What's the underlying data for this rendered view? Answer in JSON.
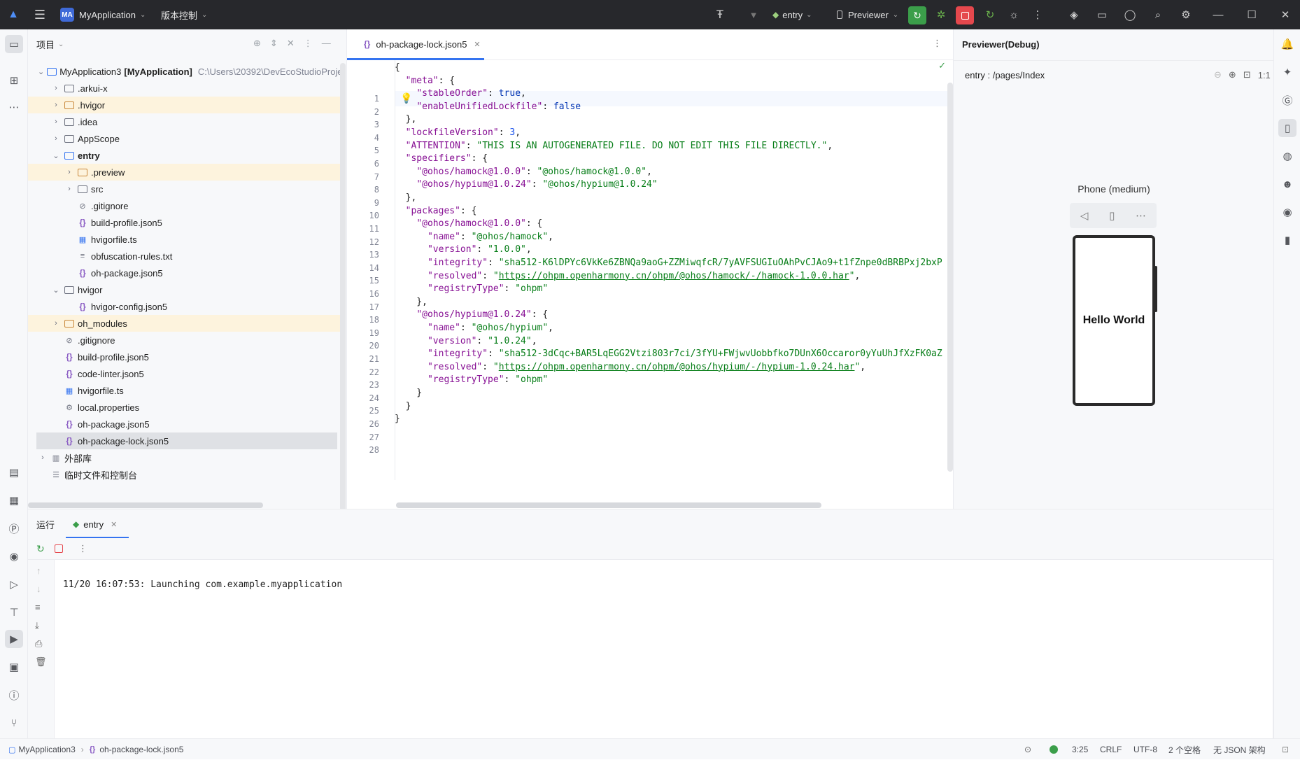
{
  "titlebar": {
    "project_initials": "MA",
    "project_name": "MyApplication",
    "vcs": "版本控制",
    "run_config": "entry",
    "device": "Previewer"
  },
  "project_panel": {
    "title": "项目",
    "root_name": "MyApplication3",
    "root_module": "[MyApplication]",
    "root_path": "C:\\Users\\20392\\DevEcoStudioProje",
    "items": [
      {
        "label": ".arkui-x"
      },
      {
        "label": ".hvigor"
      },
      {
        "label": ".idea"
      },
      {
        "label": "AppScope"
      },
      {
        "label": "entry"
      },
      {
        "label": ".preview"
      },
      {
        "label": "src"
      },
      {
        "label": ".gitignore"
      },
      {
        "label": "build-profile.json5"
      },
      {
        "label": "hvigorfile.ts"
      },
      {
        "label": "obfuscation-rules.txt"
      },
      {
        "label": "oh-package.json5"
      },
      {
        "label": "hvigor"
      },
      {
        "label": "hvigor-config.json5"
      },
      {
        "label": "oh_modules"
      },
      {
        "label": ".gitignore"
      },
      {
        "label": "build-profile.json5"
      },
      {
        "label": "code-linter.json5"
      },
      {
        "label": "hvigorfile.ts"
      },
      {
        "label": "local.properties"
      },
      {
        "label": "oh-package.json5"
      },
      {
        "label": "oh-package-lock.json5"
      },
      {
        "label": "外部库"
      },
      {
        "label": "临时文件和控制台"
      }
    ]
  },
  "editor": {
    "tab_label": "oh-package-lock.json5",
    "code": [
      {
        "t": [
          [
            "p",
            "{"
          ]
        ]
      },
      {
        "t": [
          [
            "p",
            "  "
          ],
          [
            "k",
            "\"meta\""
          ],
          [
            "p",
            ": {"
          ]
        ]
      },
      {
        "t": [
          [
            "p",
            "    "
          ],
          [
            "k",
            "\"stableOrder\""
          ],
          [
            "p",
            ": "
          ],
          [
            "b",
            "true"
          ],
          [
            "p",
            ","
          ]
        ]
      },
      {
        "t": [
          [
            "p",
            "    "
          ],
          [
            "k",
            "\"enableUnifiedLockfile\""
          ],
          [
            "p",
            ": "
          ],
          [
            "b",
            "false"
          ]
        ]
      },
      {
        "t": [
          [
            "p",
            "  },"
          ]
        ]
      },
      {
        "t": [
          [
            "p",
            "  "
          ],
          [
            "k",
            "\"lockfileVersion\""
          ],
          [
            "p",
            ": "
          ],
          [
            "n",
            "3"
          ],
          [
            "p",
            ","
          ]
        ]
      },
      {
        "t": [
          [
            "p",
            "  "
          ],
          [
            "k",
            "\"ATTENTION\""
          ],
          [
            "p",
            ": "
          ],
          [
            "s",
            "\"THIS IS AN AUTOGENERATED FILE. DO NOT EDIT THIS FILE DIRECTLY.\""
          ],
          [
            "p",
            ","
          ]
        ]
      },
      {
        "t": [
          [
            "p",
            "  "
          ],
          [
            "k",
            "\"specifiers\""
          ],
          [
            "p",
            ": {"
          ]
        ]
      },
      {
        "t": [
          [
            "p",
            "    "
          ],
          [
            "k",
            "\"@ohos/hamock@1.0.0\""
          ],
          [
            "p",
            ": "
          ],
          [
            "s",
            "\"@ohos/hamock@1.0.0\""
          ],
          [
            "p",
            ","
          ]
        ]
      },
      {
        "t": [
          [
            "p",
            "    "
          ],
          [
            "k",
            "\"@ohos/hypium@1.0.24\""
          ],
          [
            "p",
            ": "
          ],
          [
            "s",
            "\"@ohos/hypium@1.0.24\""
          ]
        ]
      },
      {
        "t": [
          [
            "p",
            "  },"
          ]
        ]
      },
      {
        "t": [
          [
            "p",
            "  "
          ],
          [
            "k",
            "\"packages\""
          ],
          [
            "p",
            ": {"
          ]
        ]
      },
      {
        "t": [
          [
            "p",
            "    "
          ],
          [
            "k",
            "\"@ohos/hamock@1.0.0\""
          ],
          [
            "p",
            ": {"
          ]
        ]
      },
      {
        "t": [
          [
            "p",
            "      "
          ],
          [
            "k",
            "\"name\""
          ],
          [
            "p",
            ": "
          ],
          [
            "s",
            "\"@ohos/hamock\""
          ],
          [
            "p",
            ","
          ]
        ]
      },
      {
        "t": [
          [
            "p",
            "      "
          ],
          [
            "k",
            "\"version\""
          ],
          [
            "p",
            ": "
          ],
          [
            "s",
            "\"1.0.0\""
          ],
          [
            "p",
            ","
          ]
        ]
      },
      {
        "t": [
          [
            "p",
            "      "
          ],
          [
            "k",
            "\"integrity\""
          ],
          [
            "p",
            ": "
          ],
          [
            "s",
            "\"sha512-K6lDPYc6VkKe6ZBNQa9aoG+ZZMiwqfcR/7yAVFSUGIuOAhPvCJAo9+t1fZnpe0dBRBPxj2bxP"
          ]
        ]
      },
      {
        "t": [
          [
            "p",
            "      "
          ],
          [
            "k",
            "\"resolved\""
          ],
          [
            "p",
            ": "
          ],
          [
            "s",
            "\""
          ],
          [
            "u",
            "https://ohpm.openharmony.cn/ohpm/@ohos/hamock/-/hamock-1.0.0.har"
          ],
          [
            "s",
            "\""
          ],
          [
            "p",
            ","
          ]
        ]
      },
      {
        "t": [
          [
            "p",
            "      "
          ],
          [
            "k",
            "\"registryType\""
          ],
          [
            "p",
            ": "
          ],
          [
            "s",
            "\"ohpm\""
          ]
        ]
      },
      {
        "t": [
          [
            "p",
            "    },"
          ]
        ]
      },
      {
        "t": [
          [
            "p",
            "    "
          ],
          [
            "k",
            "\"@ohos/hypium@1.0.24\""
          ],
          [
            "p",
            ": {"
          ]
        ]
      },
      {
        "t": [
          [
            "p",
            "      "
          ],
          [
            "k",
            "\"name\""
          ],
          [
            "p",
            ": "
          ],
          [
            "s",
            "\"@ohos/hypium\""
          ],
          [
            "p",
            ","
          ]
        ]
      },
      {
        "t": [
          [
            "p",
            "      "
          ],
          [
            "k",
            "\"version\""
          ],
          [
            "p",
            ": "
          ],
          [
            "s",
            "\"1.0.24\""
          ],
          [
            "p",
            ","
          ]
        ]
      },
      {
        "t": [
          [
            "p",
            "      "
          ],
          [
            "k",
            "\"integrity\""
          ],
          [
            "p",
            ": "
          ],
          [
            "s",
            "\"sha512-3dCqc+BAR5LqEGG2Vtzi803r7ci/3fYU+FWjwvUobbfko7DUnX6Occaror0yYuUhJfXzFK0aZ"
          ]
        ]
      },
      {
        "t": [
          [
            "p",
            "      "
          ],
          [
            "k",
            "\"resolved\""
          ],
          [
            "p",
            ": "
          ],
          [
            "s",
            "\""
          ],
          [
            "u",
            "https://ohpm.openharmony.cn/ohpm/@ohos/hypium/-/hypium-1.0.24.har"
          ],
          [
            "s",
            "\""
          ],
          [
            "p",
            ","
          ]
        ]
      },
      {
        "t": [
          [
            "p",
            "      "
          ],
          [
            "k",
            "\"registryType\""
          ],
          [
            "p",
            ": "
          ],
          [
            "s",
            "\"ohpm\""
          ]
        ]
      },
      {
        "t": [
          [
            "p",
            "    }"
          ]
        ]
      },
      {
        "t": [
          [
            "p",
            "  }"
          ]
        ]
      },
      {
        "t": [
          [
            "p",
            "}"
          ]
        ]
      }
    ]
  },
  "previewer": {
    "title": "Previewer(Debug)",
    "route": "entry : /pages/Index",
    "zoom_label": "1:1",
    "device_label": "Phone (medium)",
    "screen_text": "Hello World"
  },
  "run_panel": {
    "tab_run": "运行",
    "tab_entry": "entry",
    "log_line": "11/20 16:07:53: Launching com.example.myapplication"
  },
  "statusbar": {
    "project": "MyApplication3",
    "file": "oh-package-lock.json5",
    "position": "3:25",
    "line_sep": "CRLF",
    "encoding": "UTF-8",
    "indent": "2 个空格",
    "schema": "无 JSON 架构"
  },
  "colors": {
    "accent": "#3574f0",
    "title_bg": "#27282c",
    "run_green": "#3b9e4a",
    "stop_red": "#e5484d"
  }
}
